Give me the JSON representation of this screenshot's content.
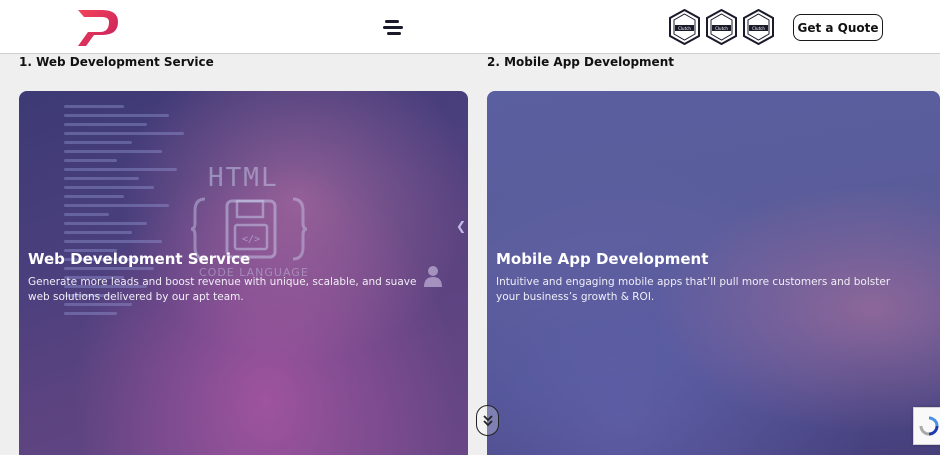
{
  "header": {
    "logo_icon": "p-logo-icon",
    "menu_icon": "hamburger-menu-icon",
    "badges": [
      "Clutch",
      "Clutch",
      "Clutch"
    ],
    "quote_button": "Get a Quote"
  },
  "sections": [
    {
      "heading": "1. Web Development Service",
      "card": {
        "title": "Web Development Service",
        "description": "Generate more leads and boost revenue with unique, scalable, and suave web solutions delivered by our apt team.",
        "image_text": "HTML",
        "image_caption": "CODE LANGUAGE"
      }
    },
    {
      "heading": "2. Mobile App Development",
      "card": {
        "title": "Mobile App Development",
        "description": "Intuitive and engaging mobile apps that’ll pull more customers and bolster your business’s growth & ROI."
      }
    }
  ],
  "colors": {
    "brand_red": "#e8334a",
    "brand_pink": "#c51f5d",
    "navy": "#1a1a2b"
  }
}
